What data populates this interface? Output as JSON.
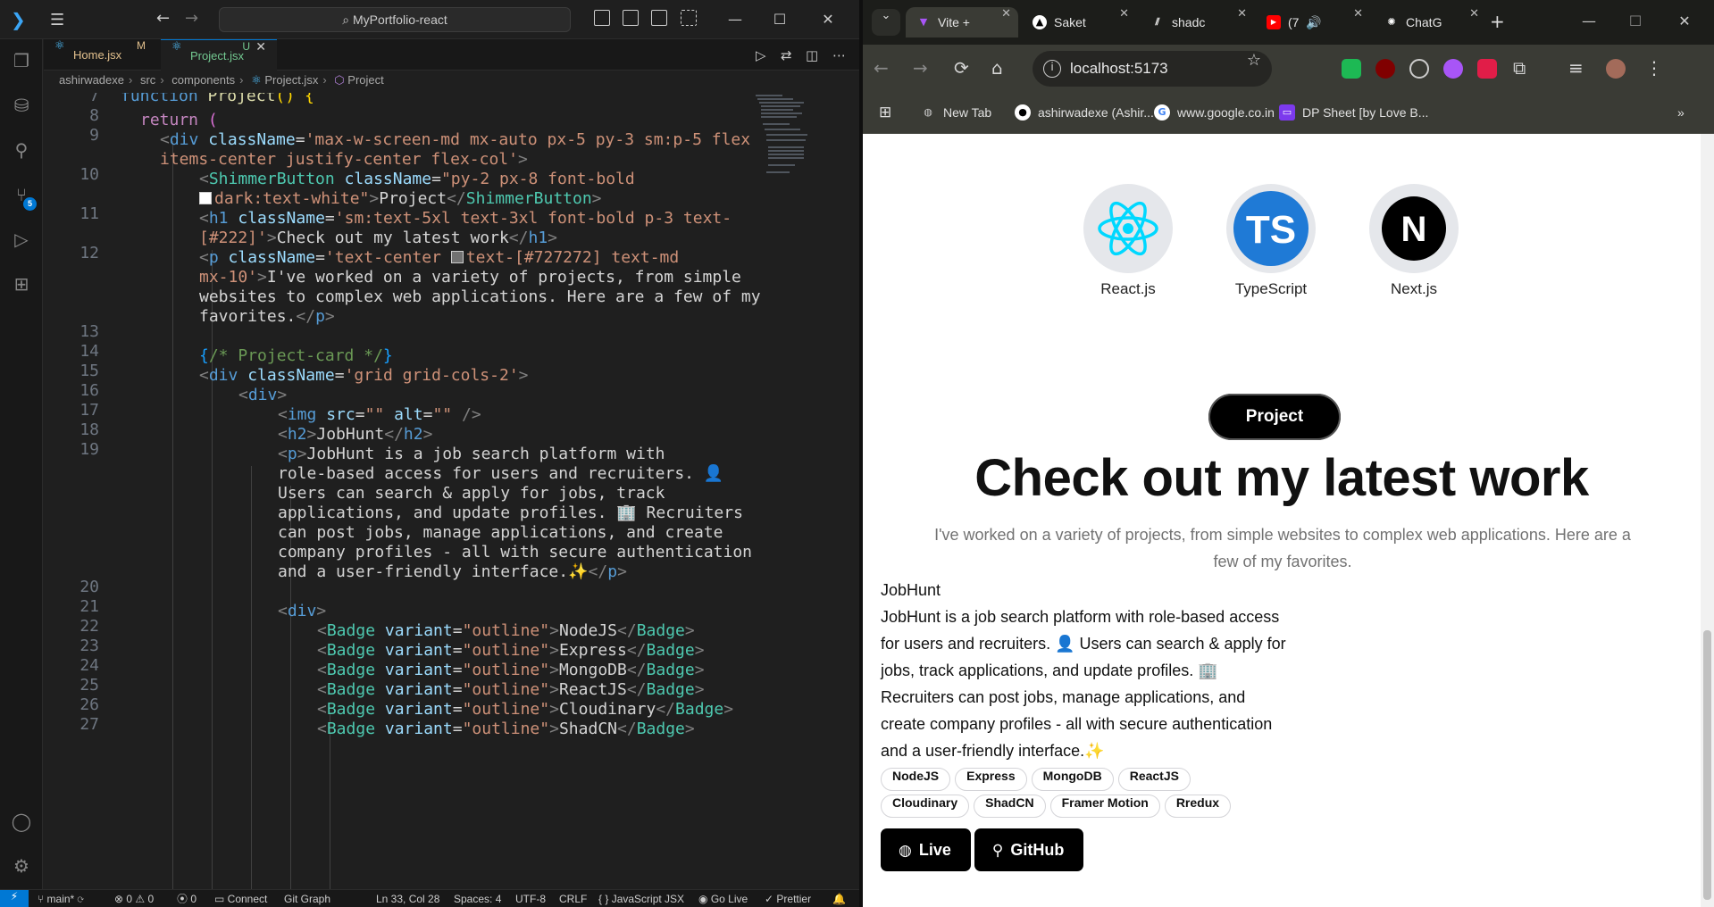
{
  "vscode": {
    "search": "MyPortfolio-react",
    "tabs": [
      {
        "label": "Home.jsx",
        "status": "M"
      },
      {
        "label": "Project.jsx",
        "status": "U"
      }
    ],
    "breadcrumb": [
      "ashirwadexe",
      "src",
      "components",
      "Project.jsx",
      "Project"
    ],
    "source_control_badge": "5",
    "status": {
      "branch": "main*",
      "problems": "0",
      "warnings": "0",
      "ports": "0",
      "connect": "Connect",
      "git_graph": "Git Graph",
      "position": "Ln 33, Col 28",
      "spaces": "Spaces: 4",
      "encoding": "UTF-8",
      "eol": "CRLF",
      "language": "JavaScript JSX",
      "go_live": "Go Live",
      "prettier": "Prettier"
    },
    "line_numbers": [
      "7",
      "8",
      "9",
      "",
      "10",
      "",
      "11",
      "",
      "12",
      "",
      "",
      "",
      "13",
      "14",
      "15",
      "16",
      "17",
      "18",
      "19",
      "",
      "",
      "",
      "",
      "",
      "",
      "20",
      "21",
      "22",
      "23",
      "24",
      "25",
      "26",
      "27"
    ]
  },
  "browser": {
    "tabs": [
      {
        "label": "Vite +",
        "icon": "vite-icon",
        "color": "#a855f7"
      },
      {
        "label": "Saket",
        "icon": "vercel-icon",
        "color": "#ffffff"
      },
      {
        "label": "shadc",
        "icon": "shadcn-icon",
        "color": "#ffffff"
      },
      {
        "label": "(7",
        "icon": "youtube-icon",
        "color": "#ff0000"
      },
      {
        "label": "ChatG",
        "icon": "openai-icon",
        "color": "#ffffff"
      }
    ],
    "url": "localhost:5173",
    "bookmarks": [
      {
        "label": "New Tab",
        "icon": "globe-icon"
      },
      {
        "label": "ashirwadexe (Ashir...",
        "icon": "github-icon"
      },
      {
        "label": "www.google.co.in",
        "icon": "google-icon"
      },
      {
        "label": "DP Sheet [by Love B...",
        "icon": "dp-sheet-icon"
      }
    ]
  },
  "page": {
    "skills": [
      {
        "label": "React.js",
        "icon": "react-icon"
      },
      {
        "label": "TypeScript",
        "icon": "typescript-icon"
      },
      {
        "label": "Next.js",
        "icon": "nextjs-icon"
      }
    ],
    "project_button": "Project",
    "title": "Check out my latest work",
    "subtitle": "I've worked on a variety of projects, from simple websites to complex web applications. Here are a few of my favorites.",
    "card": {
      "title": "JobHunt",
      "description": "JobHunt is a job search platform with role-based access for users and recruiters. 👤 Users can search & apply for jobs, track applications, and update profiles. 🏢 Recruiters can post jobs, manage applications, and create company profiles - all with secure authentication and a user-friendly interface.✨",
      "badges": [
        "NodeJS",
        "Express",
        "MongoDB",
        "ReactJS",
        "Cloudinary",
        "ShadCN",
        "Framer Motion",
        "Rredux"
      ],
      "buttons": [
        {
          "label": "Live",
          "icon": "globe-icon"
        },
        {
          "label": "GitHub",
          "icon": "github-icon"
        }
      ]
    }
  }
}
